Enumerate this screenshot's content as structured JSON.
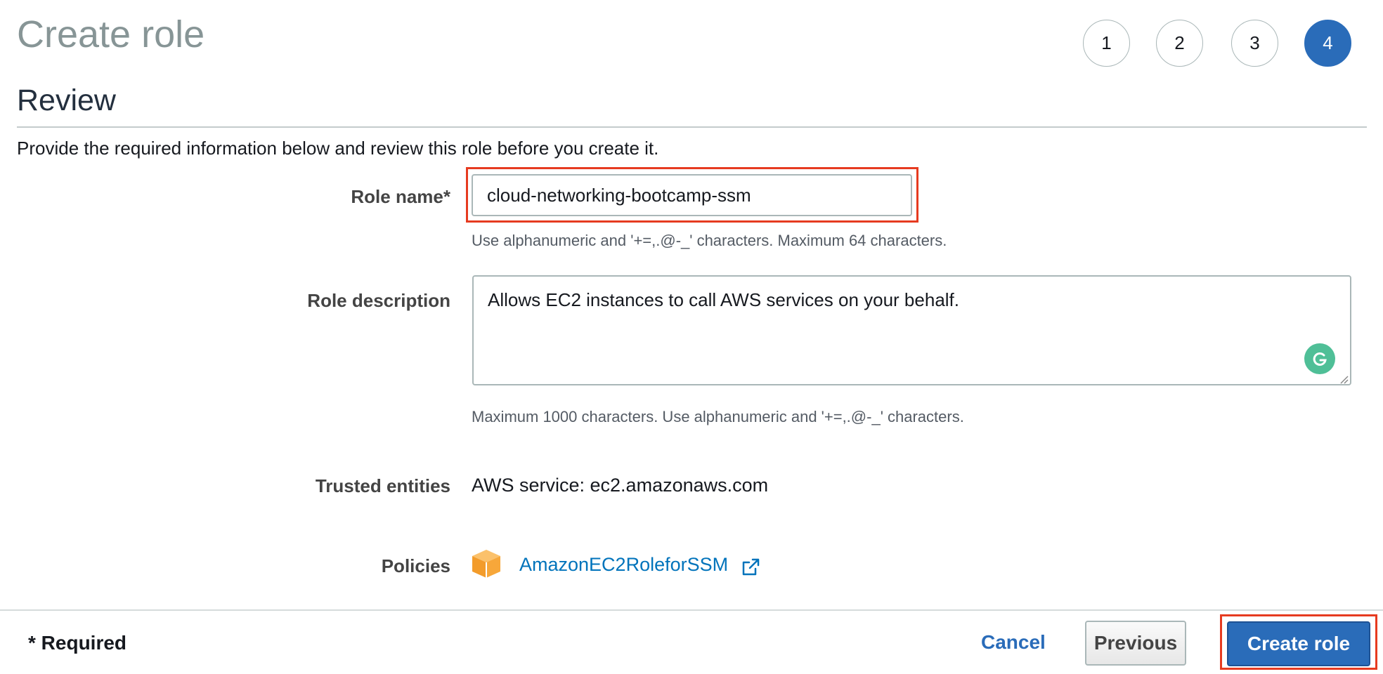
{
  "page": {
    "title": "Create role",
    "section_title": "Review",
    "intro": "Provide the required information below and review this role before you create it."
  },
  "steps": {
    "step1": "1",
    "step2": "2",
    "step3": "3",
    "step4": "4",
    "active_step": "4"
  },
  "role_name": {
    "label": "Role name*",
    "value": "cloud-networking-bootcamp-ssm",
    "hint": "Use alphanumeric and '+=,.@-_' characters. Maximum 64 characters."
  },
  "role_description": {
    "label": "Role description",
    "value": "Allows EC2 instances to call AWS services on your behalf.",
    "hint": "Maximum 1000 characters. Use alphanumeric and '+=,.@-_' characters."
  },
  "trusted_entities": {
    "label": "Trusted entities",
    "value": "AWS service: ec2.amazonaws.com"
  },
  "policies": {
    "label": "Policies",
    "policy_name": "AmazonEC2RoleforSSM",
    "icon": "policy-box-icon",
    "link_icon": "external-link-icon"
  },
  "footer": {
    "required_note": "* Required",
    "cancel_label": "Cancel",
    "previous_label": "Previous",
    "create_label": "Create role"
  },
  "colors": {
    "primary": "#2a6cb9",
    "link": "#0073bb",
    "highlight": "#e63b20",
    "policy_icon": "#f7a73a",
    "grammarly": "#4fbf97"
  }
}
